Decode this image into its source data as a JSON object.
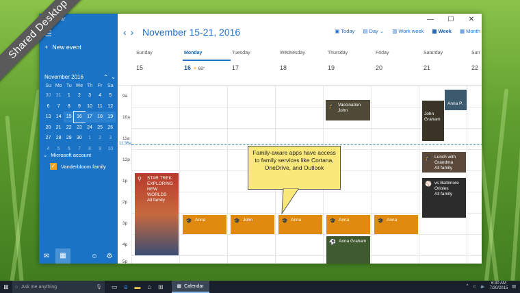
{
  "banner": "Shared Desktop",
  "window": {
    "title": "Calendar",
    "controls": [
      "—",
      "☐",
      "✕"
    ]
  },
  "sidebar": {
    "new_event": "New event",
    "month_label": "November 2016",
    "dow": [
      "Su",
      "Mo",
      "Tu",
      "We",
      "Th",
      "Fr",
      "Sa"
    ],
    "weeks": [
      [
        "30",
        "31",
        "1",
        "2",
        "3",
        "4",
        "5"
      ],
      [
        "6",
        "7",
        "8",
        "9",
        "10",
        "11",
        "12"
      ],
      [
        "13",
        "14",
        "15",
        "16",
        "17",
        "18",
        "19"
      ],
      [
        "20",
        "21",
        "22",
        "23",
        "24",
        "25",
        "26"
      ],
      [
        "27",
        "28",
        "29",
        "30",
        "1",
        "2",
        "3"
      ],
      [
        "4",
        "5",
        "6",
        "7",
        "8",
        "9",
        "10"
      ]
    ],
    "account": "Microsoft account",
    "family_calendar": "Vanderbloom family"
  },
  "toolbar": {
    "range": "November 15-21, 2016",
    "today": "Today",
    "day": "Day",
    "work_week": "Work week",
    "week": "Week",
    "month": "Month"
  },
  "days": [
    {
      "name": "Sunday",
      "num": "15"
    },
    {
      "name": "Monday",
      "num": "16",
      "weather": "68°"
    },
    {
      "name": "Tuesday",
      "num": "17"
    },
    {
      "name": "Wednesday",
      "num": "18"
    },
    {
      "name": "Thursday",
      "num": "19"
    },
    {
      "name": "Friday",
      "num": "20"
    },
    {
      "name": "Saturday",
      "num": "21"
    },
    {
      "name": "Sun",
      "num": "22"
    }
  ],
  "hours": [
    "9a",
    "10a",
    "11a",
    "12p",
    "1p",
    "2p",
    "3p",
    "4p",
    "5p"
  ],
  "now": "11:36a",
  "events": {
    "vaccination_1": "Vaccination",
    "vaccination_2": "John",
    "anna_sat": "Anna P.",
    "john_graham_1": "John",
    "john_graham_2": "Graham",
    "lunch_1": "Lunch with",
    "lunch_2": "Grandma",
    "lunch_3": "All family",
    "orioles_1": "vs Baltimore",
    "orioles_2": "Orioles",
    "orioles_3": "All family",
    "startrek_1": "STAR TREK:",
    "startrek_2": "EXPLORING",
    "startrek_3": "NEW",
    "startrek_4": "WORLDS",
    "startrek_5": "All family",
    "anna_mon": "Anna",
    "john_tue": "John",
    "anna_wed": "Anna",
    "anna_thu": "Anna",
    "anna_fri": "Anna",
    "anna_graham": "Anna Graham"
  },
  "callout": "Family-aware apps have access to family services like Cortana, OneDrive, and Outlook",
  "taskbar": {
    "search": "Ask me anything",
    "app": "Calendar",
    "time": "6:30 AM",
    "date": "7/30/2015"
  },
  "colors": {
    "accent": "#1a73c4",
    "event": "#e08b0f",
    "callout": "#fbe87a"
  }
}
